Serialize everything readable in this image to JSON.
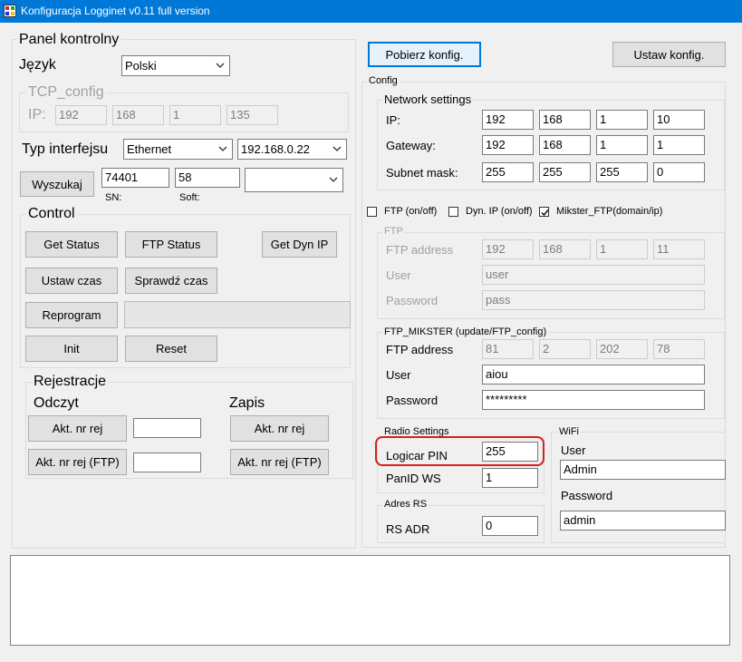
{
  "window": {
    "title": "Konfiguracja Logginet v0.11 full version"
  },
  "left": {
    "panel_title": "Panel kontrolny",
    "language_label": "Język",
    "language_value": "Polski",
    "tcp": {
      "title": "TCP_config",
      "ip_label": "IP:",
      "ip": [
        "192",
        "168",
        "1",
        "135"
      ]
    },
    "interface_label": "Typ interfejsu",
    "interface_value": "Ethernet",
    "address_value": "192.168.0.22",
    "search_button": "Wyszukaj",
    "sn_value": "74401",
    "soft_value": "58",
    "device_value": "",
    "sn_label": "SN:",
    "soft_label": "Soft:",
    "control": {
      "title": "Control",
      "get_status": "Get Status",
      "ftp_status": "FTP Status",
      "get_dyn_ip": "Get Dyn IP",
      "set_time": "Ustaw czas",
      "check_time": "Sprawdź czas",
      "reprogram": "Reprogram",
      "init": "Init",
      "reset": "Reset"
    },
    "registers": {
      "title": "Rejestracje",
      "read_title": "Odczyt",
      "write_title": "Zapis",
      "akt": "Akt. nr rej",
      "akt_ftp": "Akt. nr rej (FTP)",
      "read_akt_value": "",
      "read_ftp_value": ""
    }
  },
  "right": {
    "get_config": "Pobierz konfig.",
    "set_config": "Ustaw konfig.",
    "config_title": "Config",
    "network": {
      "title": "Network settings",
      "ip_label": "IP:",
      "ip": [
        "192",
        "168",
        "1",
        "10"
      ],
      "gateway_label": "Gateway:",
      "gateway": [
        "192",
        "168",
        "1",
        "1"
      ],
      "subnet_label": "Subnet mask:",
      "subnet": [
        "255",
        "255",
        "255",
        "0"
      ]
    },
    "checkboxes": {
      "ftp": "FTP (on/off)",
      "dynip": "Dyn. IP (on/off)",
      "mikster": "Mikster_FTP(domain/ip)"
    },
    "ftp": {
      "title": "FTP",
      "address_label": "FTP address",
      "address": [
        "192",
        "168",
        "1",
        "11"
      ],
      "user_label": "User",
      "user": "user",
      "password_label": "Password",
      "password": "pass"
    },
    "mikster": {
      "title": "FTP_MIKSTER (update/FTP_config)",
      "address_label": "FTP address",
      "address": [
        "81",
        "2",
        "202",
        "78"
      ],
      "user_label": "User",
      "user": "aiou",
      "password_label": "Password",
      "password": "*********"
    },
    "radio": {
      "title": "Radio Settings",
      "pin_label": "Logicar PIN",
      "pin": "255",
      "panid_label": "PanID WS",
      "panid": "1"
    },
    "rs": {
      "title": "Adres RS",
      "adr_label": "RS ADR",
      "adr": "0"
    },
    "wifi": {
      "title": "WiFi",
      "user_label": "User",
      "user": "Admin",
      "password_label": "Password",
      "password": "admin"
    }
  },
  "log": {
    "text": ""
  }
}
